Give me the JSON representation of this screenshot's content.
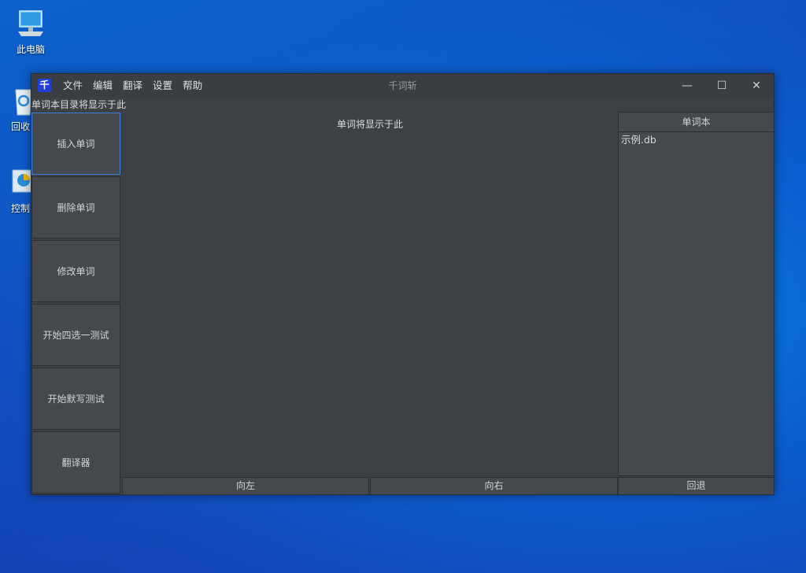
{
  "desktop": {
    "icons": [
      {
        "label": "此电脑",
        "icon": "computer-icon"
      },
      {
        "label": "回收",
        "icon": "recycle-bin-icon"
      },
      {
        "label": "控制",
        "icon": "control-panel-icon"
      }
    ]
  },
  "window": {
    "logo": "千",
    "title": "千词斩",
    "menu": [
      "文件",
      "编辑",
      "翻译",
      "设置",
      "帮助"
    ],
    "controls": {
      "minimize": "—",
      "maximize": "☐",
      "close": "✕"
    },
    "catalog_hint": "单词本目录将显示于此",
    "sidebar_buttons": [
      "插入单词",
      "删除单词",
      "修改单词",
      "开始四选一测试",
      "开始默写测试",
      "翻译器"
    ],
    "content_hint": "单词将显示于此",
    "wordbook": {
      "header": "单词本",
      "items": [
        "示例.db"
      ]
    },
    "bottom": {
      "left": "向左",
      "right": "向右",
      "back": "回退"
    }
  }
}
